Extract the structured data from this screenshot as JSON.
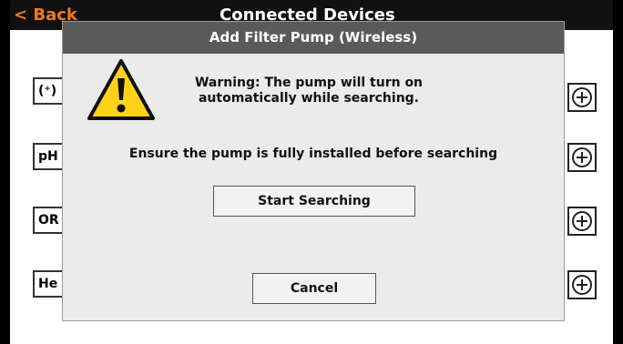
{
  "background_screen": {
    "back_label": "< Back",
    "title": "Connected Devices",
    "rows": [
      {
        "label": "(⁺)"
      },
      {
        "label": "pH"
      },
      {
        "label": "OR"
      },
      {
        "label": "He"
      }
    ]
  },
  "dialog": {
    "title": "Add Filter Pump (Wireless)",
    "warning_line1": "Warning: The pump will turn on",
    "warning_line2": "automatically while searching.",
    "instruction": "Ensure the pump is fully installed before searching",
    "start_button_label": "Start Searching",
    "cancel_button_label": "Cancel"
  },
  "colors": {
    "accent": "#f07a1e",
    "dialog_title_bg": "#5a5a5a",
    "warning_yellow": "#ffd21a"
  },
  "icons": {
    "warning": "warning-triangle-icon",
    "add": "plus-circle-icon"
  }
}
